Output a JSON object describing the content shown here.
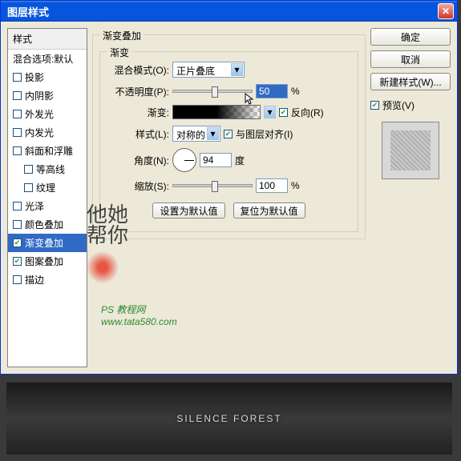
{
  "window": {
    "title": "图层样式"
  },
  "styles": {
    "header": "样式",
    "blend_defaults": "混合选项:默认",
    "items": [
      {
        "label": "投影",
        "checked": false
      },
      {
        "label": "内阴影",
        "checked": false
      },
      {
        "label": "外发光",
        "checked": false
      },
      {
        "label": "内发光",
        "checked": false
      },
      {
        "label": "斜面和浮雕",
        "checked": false
      },
      {
        "label": "等高线",
        "checked": false,
        "indent": true
      },
      {
        "label": "纹理",
        "checked": false,
        "indent": true
      },
      {
        "label": "光泽",
        "checked": false
      },
      {
        "label": "颜色叠加",
        "checked": false
      },
      {
        "label": "渐变叠加",
        "checked": true,
        "selected": true
      },
      {
        "label": "图案叠加",
        "checked": true
      },
      {
        "label": "描边",
        "checked": false
      }
    ]
  },
  "panel": {
    "title": "渐变叠加",
    "group_title": "渐变",
    "blend_mode_label": "混合模式(O):",
    "blend_mode_value": "正片叠底",
    "opacity_label": "不透明度(P):",
    "opacity_value": "50",
    "opacity_unit": "%",
    "gradient_label": "渐变:",
    "reverse_label": "反向(R)",
    "reverse_checked": true,
    "style_label": "样式(L):",
    "style_value": "对称的",
    "align_label": "与图层对齐(I)",
    "align_checked": true,
    "angle_label": "角度(N):",
    "angle_value": "94",
    "angle_unit": "度",
    "scale_label": "缩放(S):",
    "scale_value": "100",
    "scale_unit": "%",
    "default_btn": "设置为默认值",
    "reset_btn": "复位为默认值"
  },
  "right": {
    "ok": "确定",
    "cancel": "取消",
    "new_style": "新建样式(W)...",
    "preview_label": "预览(V)"
  },
  "watermark": {
    "line1": "PS 教程网",
    "line2": "www.tata580.com"
  },
  "banner_text": "SILENCE FOREST"
}
